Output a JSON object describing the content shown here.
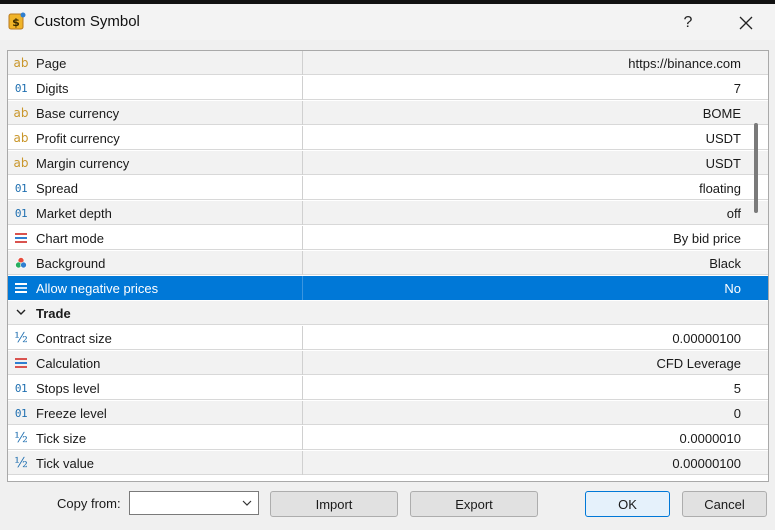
{
  "window": {
    "title": "Custom Symbol",
    "help": "?",
    "close_icon": "close-icon",
    "app_icon": "dollar-symbol-icon"
  },
  "properties": [
    {
      "icon": "ab",
      "name": "Page",
      "value": "https://binance.com"
    },
    {
      "icon": "01",
      "name": "Digits",
      "value": "7"
    },
    {
      "icon": "ab",
      "name": "Base currency",
      "value": "BOME"
    },
    {
      "icon": "ab",
      "name": "Profit currency",
      "value": "USDT"
    },
    {
      "icon": "ab",
      "name": "Margin currency",
      "value": "USDT"
    },
    {
      "icon": "01",
      "name": "Spread",
      "value": "floating"
    },
    {
      "icon": "01",
      "name": "Market depth",
      "value": "off"
    },
    {
      "icon": "list",
      "name": "Chart mode",
      "value": "By bid price"
    },
    {
      "icon": "color",
      "name": "Background",
      "value": "Black"
    },
    {
      "icon": "list",
      "name": "Allow negative prices",
      "value": "No",
      "selected": true
    }
  ],
  "section": {
    "name": "Trade",
    "expanded": true
  },
  "trade_properties": [
    {
      "icon": "half",
      "name": "Contract size",
      "value": "0.00000100"
    },
    {
      "icon": "list",
      "name": "Calculation",
      "value": "CFD Leverage"
    },
    {
      "icon": "01",
      "name": "Stops level",
      "value": "5"
    },
    {
      "icon": "01",
      "name": "Freeze level",
      "value": "0"
    },
    {
      "icon": "half",
      "name": "Tick size",
      "value": "0.0000010"
    },
    {
      "icon": "half",
      "name": "Tick value",
      "value": "0.00000100"
    }
  ],
  "footer": {
    "copy_from_label": "Copy from:",
    "copy_from_value": "",
    "import_label": "Import",
    "export_label": "Export",
    "ok_label": "OK",
    "cancel_label": "Cancel"
  },
  "colors": {
    "selection": "#0078d7",
    "accent_icon": "#1f6fb0",
    "text_icon": "#c9962a"
  }
}
